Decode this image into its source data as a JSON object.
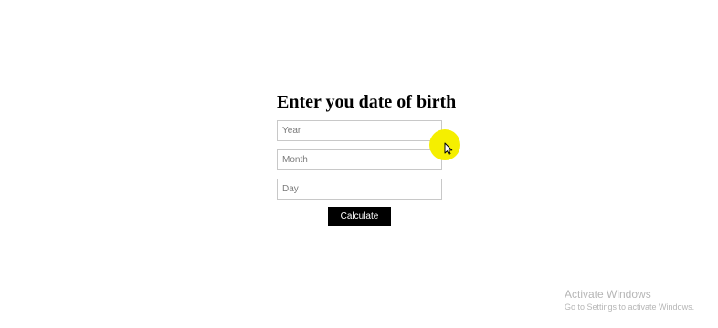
{
  "form": {
    "title": "Enter you date of birth",
    "fields": {
      "year_placeholder": "Year",
      "month_placeholder": "Month",
      "day_placeholder": "Day"
    },
    "calculate_label": "Calculate"
  },
  "watermark": {
    "title": "Activate Windows",
    "subtitle": "Go to Settings to activate Windows."
  },
  "colors": {
    "cursor_highlight": "#f5ef00",
    "button_bg": "#000000",
    "button_text": "#ffffff"
  },
  "icons": {
    "cursor": "mouse-pointer-icon"
  }
}
